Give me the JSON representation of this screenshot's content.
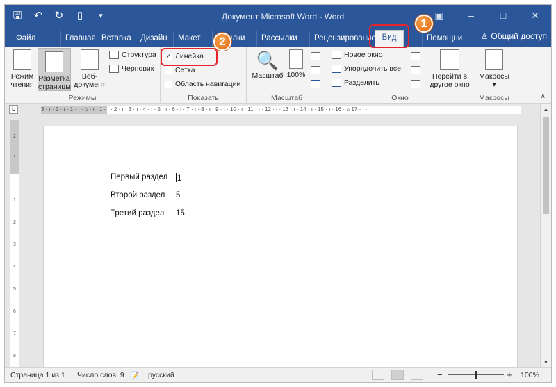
{
  "window": {
    "title": "Документ Microsoft Word - Word",
    "qat": [
      "save-icon",
      "undo-icon",
      "redo-icon",
      "new-doc-icon",
      "customize-icon"
    ],
    "controls": [
      "ribbon-display-icon",
      "minimize-icon",
      "maximize-icon",
      "close-icon"
    ]
  },
  "tabs": [
    {
      "label": "Файл"
    },
    {
      "label": "Главная"
    },
    {
      "label": "Вставка"
    },
    {
      "label": "Дизайн"
    },
    {
      "label": "Макет"
    },
    {
      "label": "Ссылки"
    },
    {
      "label": "Рассылки"
    },
    {
      "label": "Рецензирование"
    },
    {
      "label": "Вид",
      "active": true
    },
    {
      "label": "Помощни"
    }
  ],
  "share": {
    "label": "Общий доступ"
  },
  "ribbon": {
    "modes": {
      "group_label": "Режимы",
      "read_mode": [
        "Режим",
        "чтения"
      ],
      "print_layout": [
        "Разметка",
        "страницы"
      ],
      "web_layout": [
        "Веб-",
        "документ"
      ],
      "outline": "Структура",
      "draft": "Черновик"
    },
    "show": {
      "group_label": "Показать",
      "ruler": {
        "label": "Линейка",
        "checked": true
      },
      "gridlines": {
        "label": "Сетка",
        "checked": false
      },
      "nav_pane": {
        "label": "Область навигации",
        "checked": false
      }
    },
    "zoom": {
      "group_label": "Масштаб",
      "zoom": "Масштаб",
      "percent": "100%"
    },
    "window": {
      "group_label": "Окно",
      "new_window": "Новое окно",
      "arrange_all": "Упорядочить все",
      "split": "Разделить",
      "switch": [
        "Перейти в",
        "другое окно"
      ]
    },
    "macros": {
      "group_label": "Макросы",
      "macros": "Макросы"
    }
  },
  "ruler": {
    "corner": "L",
    "marks": "3 · ı · 2 · ı · 1 · ı · ⌂ · ı · 1 · ı · 2 · ı · 3 · ı · 4 · ı · 5 · ı · 6 · ı · 7 · ı · 8 · ı · 9 · ı · 10 · ı · 11 · ı · 12 · ı · 13 · ı · 14 · ı · 15 · ı · 16 · ⌂ 17 · ı ·",
    "vertical": [
      "2",
      "1",
      "1",
      "2",
      "3",
      "4",
      "5",
      "6",
      "7",
      "8"
    ]
  },
  "document": {
    "lines": [
      {
        "text": "Первый раздел",
        "page": "1"
      },
      {
        "text": "Второй раздел",
        "page": "5"
      },
      {
        "text": "Третий раздел",
        "page": "15"
      }
    ]
  },
  "status": {
    "page": "Страница 1 из 1",
    "words": "Число слов: 9",
    "language": "русский",
    "zoom_minus": "−",
    "zoom_plus": "+",
    "zoom": "100%"
  },
  "callouts": [
    {
      "number": "1",
      "target": "Вид"
    },
    {
      "number": "2",
      "target": "Линейка"
    }
  ],
  "colors": {
    "accent": "#2b579a",
    "highlight": "#e8232a",
    "badge": "#e87a1f"
  }
}
